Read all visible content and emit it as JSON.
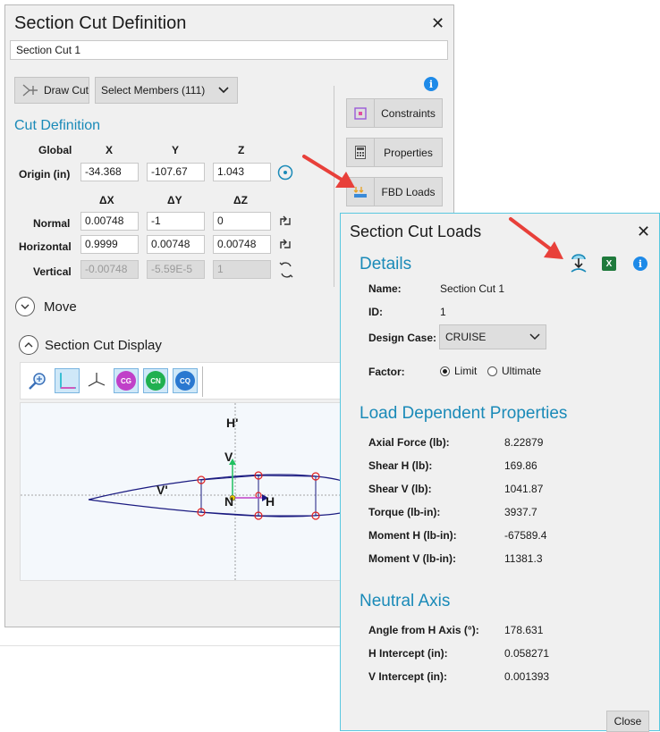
{
  "main": {
    "title": "Section Cut Definition",
    "close": "✕",
    "name_value": "Section Cut 1",
    "draw_cut_label": "Draw Cut",
    "select_members_label": "Select Members (111)",
    "cut_definition_heading": "Cut Definition",
    "col_headers": [
      "X",
      "Y",
      "Z"
    ],
    "delta_headers": [
      "ΔX",
      "ΔY",
      "ΔZ"
    ],
    "global_label": "Global",
    "origin_label": "Origin  (in)",
    "origin": [
      "-34.368",
      "-107.67",
      "1.043"
    ],
    "normal_label": "Normal",
    "normal": [
      "0.00748",
      "-1",
      "0"
    ],
    "horizontal_label": "Horizontal",
    "horizontal": [
      "0.9999",
      "0.00748",
      "0.00748"
    ],
    "vertical_label": "Vertical",
    "vertical": [
      "-0.00748",
      "-5.59E-5",
      "1"
    ],
    "move_label": "Move",
    "display_label": "Section Cut Display",
    "side_buttons": {
      "constraints": "Constraints",
      "properties": "Properties",
      "fbd_loads": "FBD Loads"
    },
    "toolbar_pills": [
      "CG",
      "CN",
      "CQ"
    ],
    "plot_labels": {
      "h_prime": "H'",
      "v": "V",
      "v_prime": "V'",
      "n": "N",
      "h": "H"
    }
  },
  "loads": {
    "title": "Section Cut Loads",
    "close": "✕",
    "details_heading": "Details",
    "name_label": "Name:",
    "name_value": "Section Cut 1",
    "id_label": "ID:",
    "id_value": "1",
    "design_case_label": "Design Case:",
    "design_case_value": "CRUISE",
    "factor_label": "Factor:",
    "limit_label": "Limit",
    "ultimate_label": "Ultimate",
    "ldp_heading": "Load Dependent Properties",
    "ldp_rows": [
      {
        "label": "Axial Force (lb):",
        "value": "8.22879"
      },
      {
        "label": "Shear H (lb):",
        "value": "169.86"
      },
      {
        "label": "Shear V (lb):",
        "value": "1041.87"
      },
      {
        "label": "Torque (lb-in):",
        "value": "3937.7"
      },
      {
        "label": "Moment H (lb-in):",
        "value": "-67589.4"
      },
      {
        "label": "Moment V (lb-in):",
        "value": "11381.3"
      }
    ],
    "na_heading": "Neutral Axis",
    "na_rows": [
      {
        "label": "Angle from H Axis (°):",
        "value": "178.631"
      },
      {
        "label": "H Intercept (in):",
        "value": "0.058271"
      },
      {
        "label": "V Intercept (in):",
        "value": "0.001393"
      }
    ],
    "close_button": "Close"
  },
  "colors": {
    "accent": "#1a8ab8",
    "arrow": "#e8403a",
    "info": "#1e8ae8"
  }
}
